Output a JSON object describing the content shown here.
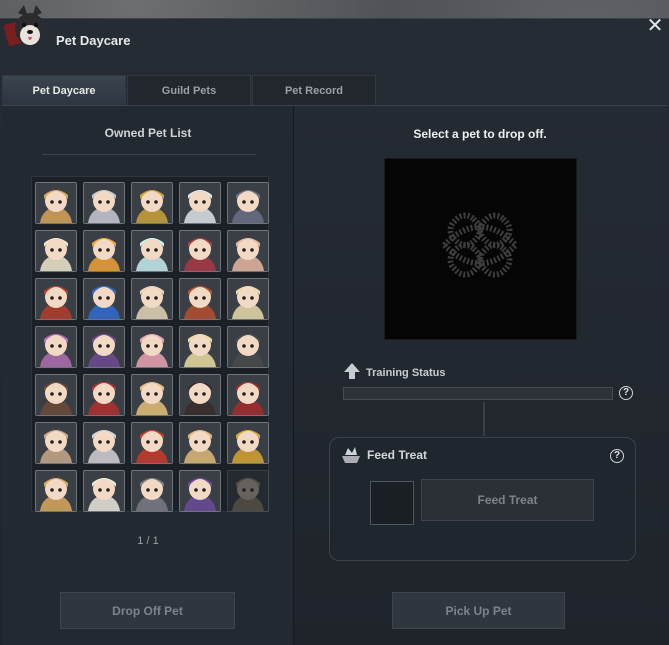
{
  "window": {
    "title": "Pet Daycare"
  },
  "tabs": [
    {
      "label": "Pet Daycare",
      "active": true
    },
    {
      "label": "Guild Pets",
      "active": false
    },
    {
      "label": "Pet Record",
      "active": false
    }
  ],
  "left": {
    "title": "Owned Pet List",
    "pagination": "1 / 1",
    "drop_off_label": "Drop Off Pet",
    "pets": [
      {
        "icon": "fox-pet-icon",
        "color": "#d8a35a"
      },
      {
        "icon": "armored-wolf-pet-icon",
        "color": "#c9c9d6"
      },
      {
        "icon": "dark-knight-pet-icon",
        "color": "#caa23a"
      },
      {
        "icon": "white-knight-pet-icon",
        "color": "#dfe3ea"
      },
      {
        "icon": "shadow-knight-pet-icon",
        "color": "#6b6f86"
      },
      {
        "icon": "white-haired-girl-pet-icon",
        "color": "#efe6cf"
      },
      {
        "icon": "golden-bear-pet-icon",
        "color": "#f0a234"
      },
      {
        "icon": "white-wolf-pet-icon",
        "color": "#c9eff0"
      },
      {
        "icon": "black-wolf-pet-icon",
        "color": "#a83a45"
      },
      {
        "icon": "red-panda-pet-icon",
        "color": "#e8b7a0"
      },
      {
        "icon": "panda-red-hood-pet-icon",
        "color": "#b33d2a"
      },
      {
        "icon": "panda-blue-hood-pet-icon",
        "color": "#2f6ccf"
      },
      {
        "icon": "penguin-pet-icon",
        "color": "#e6d6b8"
      },
      {
        "icon": "red-fox-pet-icon",
        "color": "#b5502e"
      },
      {
        "icon": "penguin-cream-pet-icon",
        "color": "#eadca8"
      },
      {
        "icon": "leopard-girl-pet-icon",
        "color": "#b26fb3"
      },
      {
        "icon": "maid-girl-pet-icon",
        "color": "#6f4a92"
      },
      {
        "icon": "pink-hair-girl-pet-icon",
        "color": "#eaa4b4"
      },
      {
        "icon": "blonde-girl-pet-icon",
        "color": "#eadca0"
      },
      {
        "icon": "masked-girl-pet-icon",
        "color": "#4a4a4a"
      },
      {
        "icon": "brown-hair-girl-pet-icon",
        "color": "#6b4a3a"
      },
      {
        "icon": "red-hair-girl-pet-icon",
        "color": "#b03030"
      },
      {
        "icon": "cat-ear-girl-pet-icon",
        "color": "#e8c078"
      },
      {
        "icon": "black-hair-girl-pet-icon",
        "color": "#3a2c2a"
      },
      {
        "icon": "red-riding-hood-pet-icon",
        "color": "#a32c2c"
      },
      {
        "icon": "helmet-knight-pet-icon",
        "color": "#c8a88a"
      },
      {
        "icon": "silver-helmet-pet-icon",
        "color": "#d4d2d6"
      },
      {
        "icon": "santa-girl-pet-icon",
        "color": "#c83a2a"
      },
      {
        "icon": "blonde-boy-pet-icon",
        "color": "#e0b878"
      },
      {
        "icon": "gold-armor-pet-icon",
        "color": "#d6a532"
      },
      {
        "icon": "pirate-penguin-pet-icon",
        "color": "#d9a85a"
      },
      {
        "icon": "white-lady-pet-icon",
        "color": "#ece8dc"
      },
      {
        "icon": "dark-warrior-pet-icon",
        "color": "#7a7a86"
      },
      {
        "icon": "purple-witch-pet-icon",
        "color": "#6a4b9a"
      },
      {
        "icon": "faded-penguin-pet-icon",
        "color": "#b8a57a"
      }
    ]
  },
  "right": {
    "prompt": "Select a pet to drop off.",
    "training_label": "Training Status",
    "training_progress": 0,
    "feed_label": "Feed Treat",
    "feed_button": "Feed Treat",
    "pick_up_label": "Pick Up Pet",
    "help_glyph": "?"
  },
  "colors": {
    "bg": "#232930",
    "accent": "#5c8fb8",
    "text": "#f0f0f0"
  }
}
